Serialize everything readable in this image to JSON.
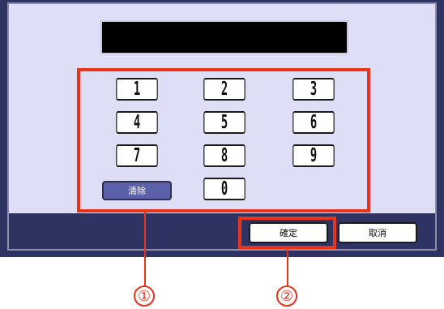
{
  "keypad": {
    "keys": [
      "1",
      "2",
      "3",
      "4",
      "5",
      "6",
      "7",
      "8",
      "9",
      "0"
    ],
    "clear_label": "清除"
  },
  "actions": {
    "confirm_label": "確定",
    "cancel_label": "取消"
  },
  "callouts": {
    "one": "①",
    "two": "②"
  },
  "colors": {
    "frame": "#2e3361",
    "panel": "#dedef6",
    "highlight": "#e8341a",
    "clear_button": "#5a61a8"
  }
}
